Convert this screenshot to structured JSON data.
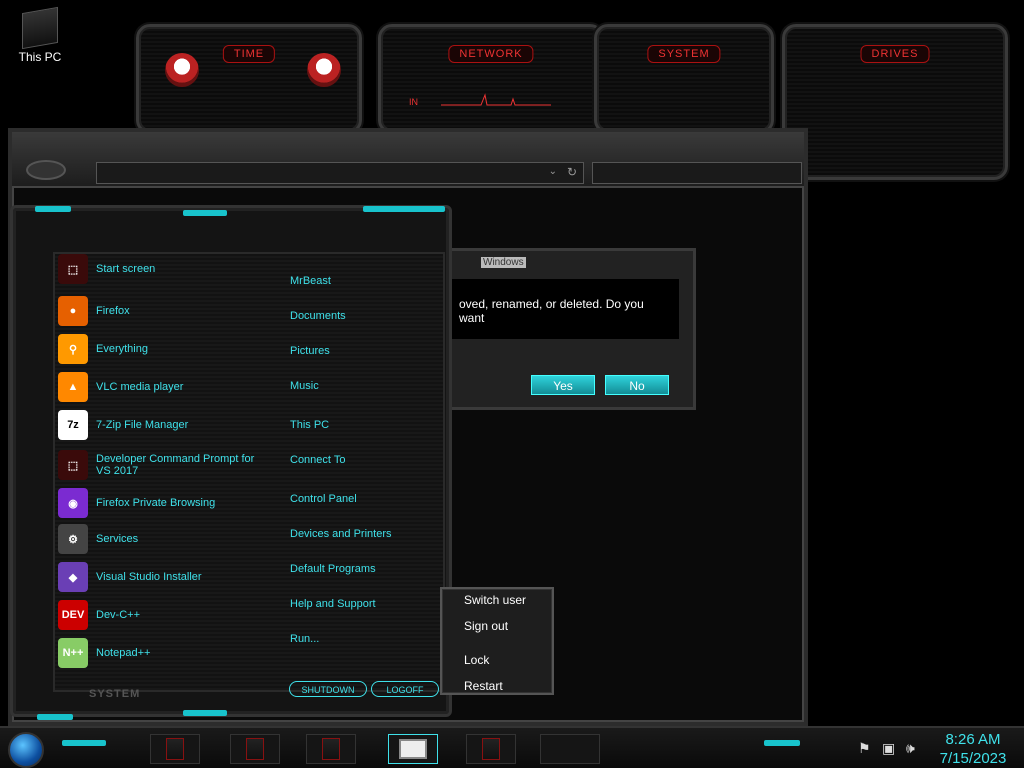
{
  "desktop": {
    "icon_label": "This PC"
  },
  "gadgets": {
    "time": "TIME",
    "network": "NETWORK",
    "network_in": "IN",
    "system": "SYSTEM",
    "drives": "DRIVES"
  },
  "dialog": {
    "title": "Windows",
    "message": "oved, renamed, or deleted. Do you want",
    "yes": "Yes",
    "no": "No"
  },
  "start_menu": {
    "programs": [
      {
        "label": "Start screen",
        "icon": "start-screen-icon",
        "color": "#3a0a0a",
        "glyph": "⬚"
      },
      {
        "label": "Firefox",
        "icon": "firefox-icon",
        "color": "#e66000",
        "glyph": "●"
      },
      {
        "label": "Everything",
        "icon": "everything-icon",
        "color": "#f90",
        "glyph": "⚲"
      },
      {
        "label": "VLC media player",
        "icon": "vlc-icon",
        "color": "#f80",
        "glyph": "▲"
      },
      {
        "label": "7-Zip File Manager",
        "icon": "7zip-icon",
        "color": "#fff",
        "glyph": "7z"
      },
      {
        "label": "Developer Command Prompt for VS 2017",
        "icon": "dev-cmd-icon",
        "color": "#3a0a0a",
        "glyph": "⬚"
      },
      {
        "label": "Firefox Private Browsing",
        "icon": "firefox-private-icon",
        "color": "#7b2bd1",
        "glyph": "◉"
      },
      {
        "label": "Services",
        "icon": "services-gear-icon",
        "color": "#444",
        "glyph": "⚙"
      },
      {
        "label": "Visual Studio Installer",
        "icon": "vs-installer-icon",
        "color": "#6a3fb5",
        "glyph": "◆"
      },
      {
        "label": "Dev-C++",
        "icon": "devcpp-icon",
        "color": "#c00",
        "glyph": "DEV"
      },
      {
        "label": "Notepad++",
        "icon": "notepadpp-icon",
        "color": "#8c6",
        "glyph": "N++"
      }
    ],
    "links": [
      "MrBeast",
      "Documents",
      "Pictures",
      "Music",
      "This PC",
      "Connect To",
      "Control Panel",
      "Devices and Printers",
      "Default Programs",
      "Help and Support",
      "Run..."
    ],
    "footer_label": "SYSTEM",
    "shutdown": "SHUTDOWN",
    "logoff": "LOGOFF"
  },
  "context_menu": [
    "Switch user",
    "Sign out",
    "Lock",
    "Restart"
  ],
  "taskbar": {
    "time": "8:26 AM",
    "date": "7/15/2023"
  },
  "colors": {
    "accent": "#3fe1ea",
    "gadget_red": "#e33"
  }
}
